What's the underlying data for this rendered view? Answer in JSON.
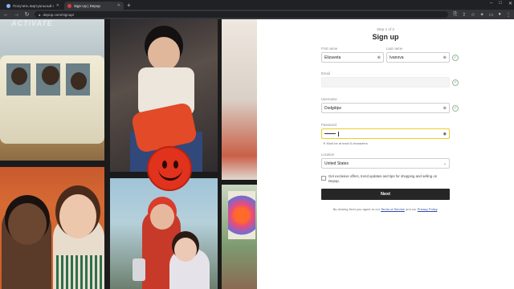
{
  "browser": {
    "tabs": [
      {
        "title": "Получить виртуальный номер...",
        "active": false
      },
      {
        "title": "Sign Up | Depop",
        "active": true
      }
    ],
    "new_tab": "+",
    "window_controls": [
      "–",
      "□",
      "✕"
    ],
    "address": "depop.com/signup/",
    "nav_icons": [
      "back-icon",
      "forward-icon",
      "reload-icon"
    ]
  },
  "watermark": "ACTIVATE",
  "form": {
    "step": "Step 1 of 3",
    "title": "Sign up",
    "first_name": {
      "label": "First name",
      "value": "Elizaveta"
    },
    "last_name": {
      "label": "Last name",
      "value": "Ivanova"
    },
    "email": {
      "label": "Email",
      "value": ""
    },
    "username": {
      "label": "Username",
      "value": "Dsdgdqw"
    },
    "password": {
      "label": "Password",
      "hint": "Must be at least 6 characters",
      "hint_prefix": "✕"
    },
    "location": {
      "label": "Location",
      "value": "United States"
    },
    "marketing_checkbox": "Get exclusive offers, trend updates and tips for shopping and selling on Depop.",
    "next_button": "Next",
    "terms": {
      "prefix": "By clicking Next you agree to our ",
      "terms_link": "Terms of Service",
      "middle": " and our ",
      "privacy_link": "Privacy Policy",
      "suffix": "."
    }
  },
  "colors": {
    "focus": "#e6cf2a",
    "button": "#262626",
    "link": "#2f4fa3"
  }
}
